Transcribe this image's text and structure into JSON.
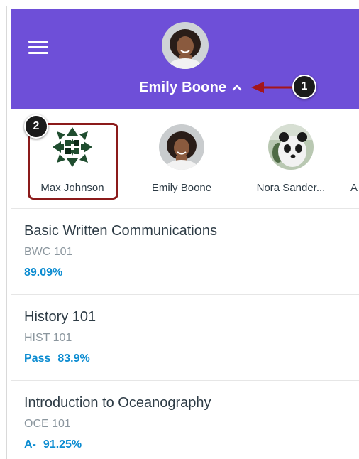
{
  "header": {
    "current_user": "Emily Boone",
    "background_color": "#6e4fd8",
    "menu_icon": "hamburger-menu-icon",
    "caret_icon": "caret-up-icon"
  },
  "callouts": {
    "one": "1",
    "two": "2"
  },
  "students": [
    {
      "name": "Max Johnson",
      "avatar": "geometric-pattern-avatar",
      "highlighted": true
    },
    {
      "name": "Emily Boone",
      "avatar": "portrait-avatar"
    },
    {
      "name": "Nora Sander...",
      "avatar": "panda-avatar"
    },
    {
      "name": "A",
      "avatar": ""
    }
  ],
  "courses": [
    {
      "title": "Basic Written Communications",
      "code": "BWC 101",
      "letter": "",
      "score": "89.09%"
    },
    {
      "title": "History 101",
      "code": "HIST 101",
      "letter": "Pass",
      "score": "83.9%"
    },
    {
      "title": "Introduction to Oceanography",
      "code": "OCE 101",
      "letter": "A-",
      "score": "91.25%"
    }
  ],
  "colors": {
    "grade": "#0c8cd1",
    "highlight": "#8b1a1a",
    "text": "#2d3b45"
  }
}
